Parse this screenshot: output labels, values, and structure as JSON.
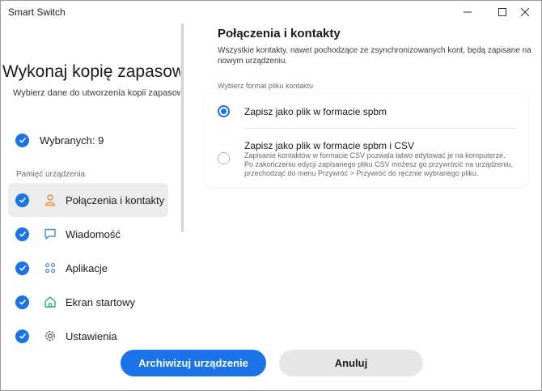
{
  "window": {
    "title": "Smart Switch"
  },
  "left": {
    "title": "Wykonaj kopię zapasową e",
    "subtitle": "Wybierz dane do utworzenia kopii zapasowej",
    "selected_label": "Wybranych: 9",
    "section_label": "Pamięć urządzenia",
    "categories": [
      {
        "label": "Połączenia i kontakty",
        "icon": "contact-icon",
        "checked": true,
        "active": true
      },
      {
        "label": "Wiadomość",
        "icon": "message-icon",
        "checked": true,
        "active": false
      },
      {
        "label": "Aplikacje",
        "icon": "apps-icon",
        "checked": true,
        "active": false
      },
      {
        "label": "Ekran startowy",
        "icon": "home-icon",
        "checked": true,
        "active": false
      },
      {
        "label": "Ustawienia",
        "icon": "gear-icon",
        "checked": true,
        "active": false
      }
    ]
  },
  "right": {
    "title": "Połączenia i kontakty",
    "description": "Wszystkie kontakty, nawet pochodzące ze zsynchronizowanych kont, będą zapisane na nowym urządzeniu.",
    "format_label": "Wybierz format pliku kontaktu",
    "options": [
      {
        "label": "Zapisz jako plik w formacie spbm",
        "selected": true
      },
      {
        "label": "Zapisz jako plik w formacie spbm i CSV",
        "selected": false,
        "description": "Zapisanie kontaktów w formacie CSV pozwala łatwo edytować je na komputerze. Po zakończeniu edycji zapisanego pliku CSV możesz go przywrócić na urządzeniu, przechodząc do menu Przywróć > Przywróć do ręcznie wybranego pliku."
      }
    ]
  },
  "buttons": {
    "primary": "Archiwizuj urządzenie",
    "secondary": "Anuluj"
  },
  "colors": {
    "accent": "#1a73e8",
    "contact_icon": "#f08c3a",
    "message_icon": "#3a8fe8",
    "apps_icon": "#5b8fd9",
    "home_icon": "#27a78c",
    "gear_icon": "#555555"
  }
}
